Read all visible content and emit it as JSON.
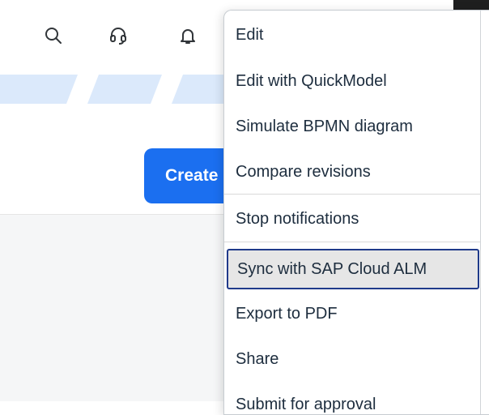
{
  "header": {
    "icons": [
      "search-icon",
      "headset-icon",
      "bell-icon"
    ]
  },
  "toolbar": {
    "create_label": "Create"
  },
  "menu": {
    "items": [
      "Edit",
      "Edit with QuickModel",
      "Simulate BPMN diagram",
      "Compare revisions",
      "Stop notifications",
      "Sync with SAP Cloud ALM",
      "Export to PDF",
      "Share",
      "Submit for approval"
    ],
    "focused_item": "Sync with SAP Cloud ALM"
  },
  "colors": {
    "accent": "#1b6ff0",
    "focus_border": "#1f3a8a",
    "stripe": "#dbe9fb"
  }
}
